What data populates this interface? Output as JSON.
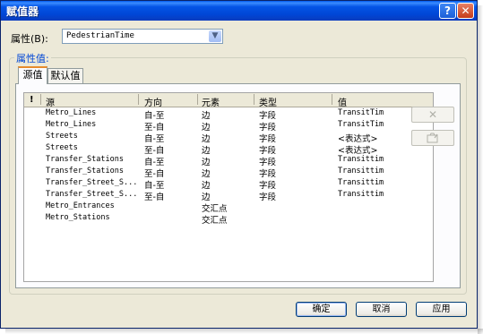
{
  "window": {
    "title": "赋值器",
    "help_glyph": "?",
    "close_glyph": "✕"
  },
  "attribute": {
    "label": "属性(B):",
    "selected": "PedestrianTime"
  },
  "group": {
    "title": "属性值:"
  },
  "tabs": [
    {
      "label": "源值"
    },
    {
      "label": "默认值"
    }
  ],
  "table": {
    "columns": {
      "flag": "!",
      "source": "源",
      "direction": "方向",
      "element": "元素",
      "type": "类型",
      "value": "值"
    },
    "rows": [
      {
        "source": "Metro_Lines",
        "direction": "自-至",
        "element": "边",
        "type": "字段",
        "value": "TransitTim"
      },
      {
        "source": "Metro_Lines",
        "direction": "至-自",
        "element": "边",
        "type": "字段",
        "value": "TransitTim"
      },
      {
        "source": "Streets",
        "direction": "自-至",
        "element": "边",
        "type": "字段",
        "value": "<表达式>"
      },
      {
        "source": "Streets",
        "direction": "至-自",
        "element": "边",
        "type": "字段",
        "value": "<表达式>"
      },
      {
        "source": "Transfer_Stations",
        "direction": "自-至",
        "element": "边",
        "type": "字段",
        "value": "Transittim"
      },
      {
        "source": "Transfer_Stations",
        "direction": "至-自",
        "element": "边",
        "type": "字段",
        "value": "Transittim"
      },
      {
        "source": "Transfer_Street_S...",
        "direction": "自-至",
        "element": "边",
        "type": "字段",
        "value": "Transittim"
      },
      {
        "source": "Transfer_Street_S...",
        "direction": "至-自",
        "element": "边",
        "type": "字段",
        "value": "Transittim"
      },
      {
        "source": "Metro_Entrances",
        "direction": "",
        "element": "交汇点",
        "type": "",
        "value": ""
      },
      {
        "source": "Metro_Stations",
        "direction": "",
        "element": "交汇点",
        "type": "",
        "value": ""
      }
    ]
  },
  "side_buttons": {
    "remove_glyph": "✕",
    "edit_icon": "edit-icon"
  },
  "buttons": {
    "ok": "确定",
    "cancel": "取消",
    "apply": "应用"
  }
}
